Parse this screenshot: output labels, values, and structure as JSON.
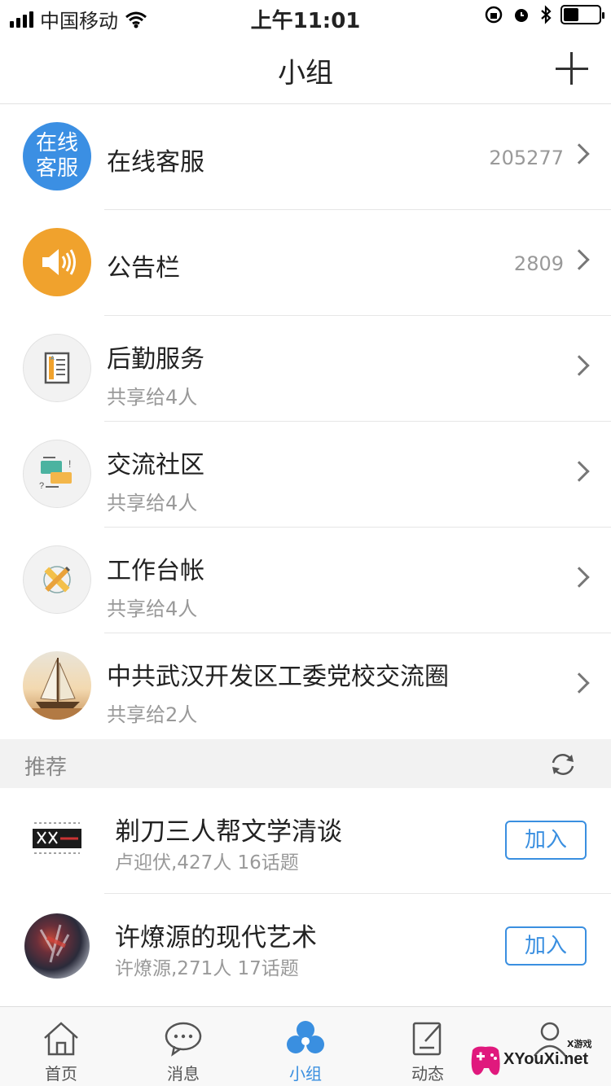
{
  "status_bar": {
    "carrier": "中国移动",
    "time": "上午11:01"
  },
  "nav": {
    "title": "小组",
    "add_icon": "plus-icon"
  },
  "groups": [
    {
      "title": "在线客服",
      "subtitle": "",
      "count": "205277",
      "avatar_text_1": "在线",
      "avatar_text_2": "客服",
      "avatar_color": "#3b8fe3",
      "icon": "customer-service-icon"
    },
    {
      "title": "公告栏",
      "subtitle": "",
      "count": "2809",
      "avatar_color": "#f0a22d",
      "icon": "speaker-icon"
    },
    {
      "title": "后勤服务",
      "subtitle": "共享给4人",
      "count": "",
      "icon": "document-icon"
    },
    {
      "title": "交流社区",
      "subtitle": "共享给4人",
      "count": "",
      "icon": "chat-bubbles-icon"
    },
    {
      "title": "工作台帐",
      "subtitle": "共享给4人",
      "count": "",
      "icon": "pencil-ruler-icon"
    },
    {
      "title": "中共武汉开发区工委党校交流圈",
      "subtitle": "共享给2人",
      "count": "",
      "icon": "sailboat-photo"
    }
  ],
  "recommend": {
    "label": "推荐",
    "refresh_icon": "refresh-icon",
    "items": [
      {
        "title": "剃刀三人帮文学清谈",
        "subtitle": "卢迎伏,427人 16话题",
        "join_label": "加入"
      },
      {
        "title": "许燎源的现代艺术",
        "subtitle": "许燎源,271人 17话题",
        "join_label": "加入"
      }
    ]
  },
  "tabs": [
    {
      "label": "首页",
      "icon": "home-icon"
    },
    {
      "label": "消息",
      "icon": "message-icon"
    },
    {
      "label": "小组",
      "icon": "group-icon"
    },
    {
      "label": "动态",
      "icon": "edit-icon"
    },
    {
      "label": "",
      "icon": "profile-icon"
    }
  ],
  "watermark": {
    "text": "XYouXi.net",
    "small": "X游戏"
  },
  "colors": {
    "accent": "#3a8fe0",
    "orange": "#f0a22d"
  }
}
